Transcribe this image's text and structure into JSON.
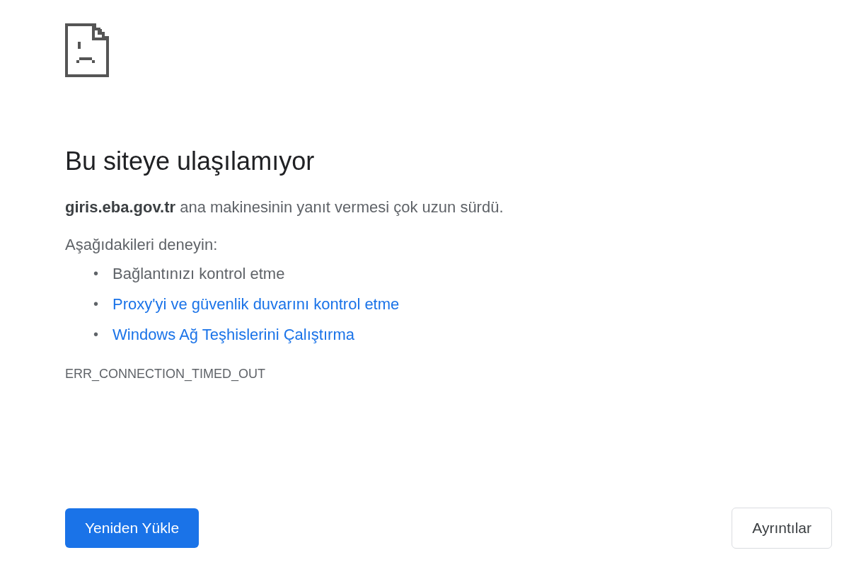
{
  "error_page": {
    "heading": "Bu siteye ulaşılamıyor",
    "summary": "**giris.eba.gov.tr** ana makinesinin yanıt vermesi çok uzun sürdü.",
    "suggestions_intro": "Aşağıdakileri deneyin:",
    "suggestions": [
      {
        "kind": "text",
        "bullet": "•",
        "label": "Bağlantınızı kontrol etme"
      },
      {
        "kind": "link",
        "bullet": "•",
        "label": "Proxy'yi ve güvenlik duvarını kontrol etme"
      },
      {
        "kind": "link",
        "bullet": "•",
        "label": "Windows Ağ Teşhislerini Çalıştırma"
      }
    ],
    "error_code": "ERR_CONNECTION_TIMED_OUT",
    "reload_button": "Yeniden Yükle",
    "details_button": "Ayrıntılar"
  }
}
